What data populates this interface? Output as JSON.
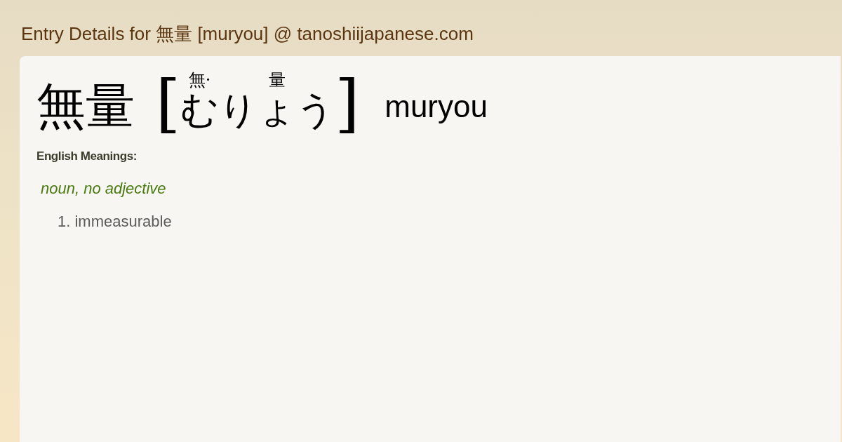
{
  "page_title": "Entry Details for 無量 [muryou] @ tanoshiijapanese.com",
  "entry": {
    "word": "無量",
    "open_bracket": "[",
    "close_bracket": "]",
    "reading": [
      {
        "furigana": "無·",
        "kana": "む"
      },
      {
        "furigana": "量",
        "kana": "りょう"
      }
    ],
    "romaji": "muryou"
  },
  "meanings_heading": "English Meanings:",
  "part_of_speech": "noun, no adjective",
  "meanings": [
    {
      "number": "1.",
      "text": "immeasurable"
    }
  ]
}
